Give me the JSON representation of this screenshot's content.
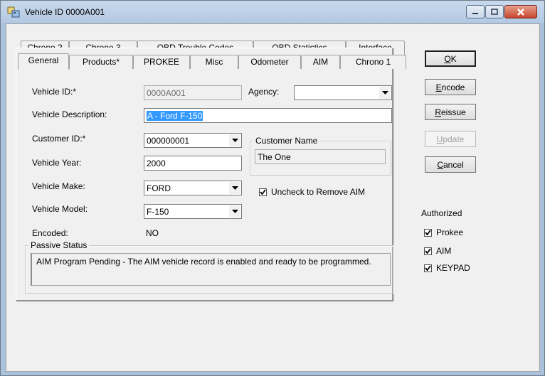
{
  "window": {
    "title": "Vehicle ID 0000A001"
  },
  "tabs_row1": [
    "Chrono 2",
    "Chrono 3",
    "OBD Trouble Codes",
    "OBD Statistics",
    "Interface"
  ],
  "tabs_row2": [
    "General",
    "Products*",
    "PROKEE",
    "Misc",
    "Odometer",
    "AIM",
    "Chrono 1"
  ],
  "active_tab": "General",
  "form": {
    "vehicle_id_label": "Vehicle ID:*",
    "vehicle_id_value": "0000A001",
    "agency_label": "Agency:",
    "agency_value": "",
    "vehicle_description_label": "Vehicle Description:",
    "vehicle_description_value": "A - Ford F-150",
    "customer_id_label": "Customer ID:*",
    "customer_id_value": "000000001",
    "customer_name_label": "Customer Name",
    "customer_name_value": "The One",
    "vehicle_year_label": "Vehicle Year:",
    "vehicle_year_value": "2000",
    "vehicle_make_label": "Vehicle Make:",
    "vehicle_make_value": "FORD",
    "uncheck_aim_label": "Uncheck to Remove AIM",
    "uncheck_aim_checked": true,
    "vehicle_model_label": "Vehicle Model:",
    "vehicle_model_value": "F-150",
    "encoded_label": "Encoded:",
    "encoded_value": "NO",
    "passive_status_label": "Passive Status",
    "passive_status_text": "AIM Program Pending - The AIM vehicle record is enabled and ready to be programmed."
  },
  "buttons": {
    "ok_first": "O",
    "ok_rest": "K",
    "encode_first": "E",
    "encode_rest": "ncode",
    "reissue_first": "R",
    "reissue_rest": "eissue",
    "update_first": "U",
    "update_rest": "pdate",
    "cancel_first": "C",
    "cancel_rest": "ancel"
  },
  "authorized": {
    "label": "Authorized",
    "items": [
      {
        "label": "Prokee",
        "checked": true
      },
      {
        "label": "AIM",
        "checked": true
      },
      {
        "label": "KEYPAD",
        "checked": true
      }
    ]
  },
  "colors": {
    "selection": "#3399ff",
    "titlebar": "#b9cde6",
    "close_button": "#c8462d"
  }
}
